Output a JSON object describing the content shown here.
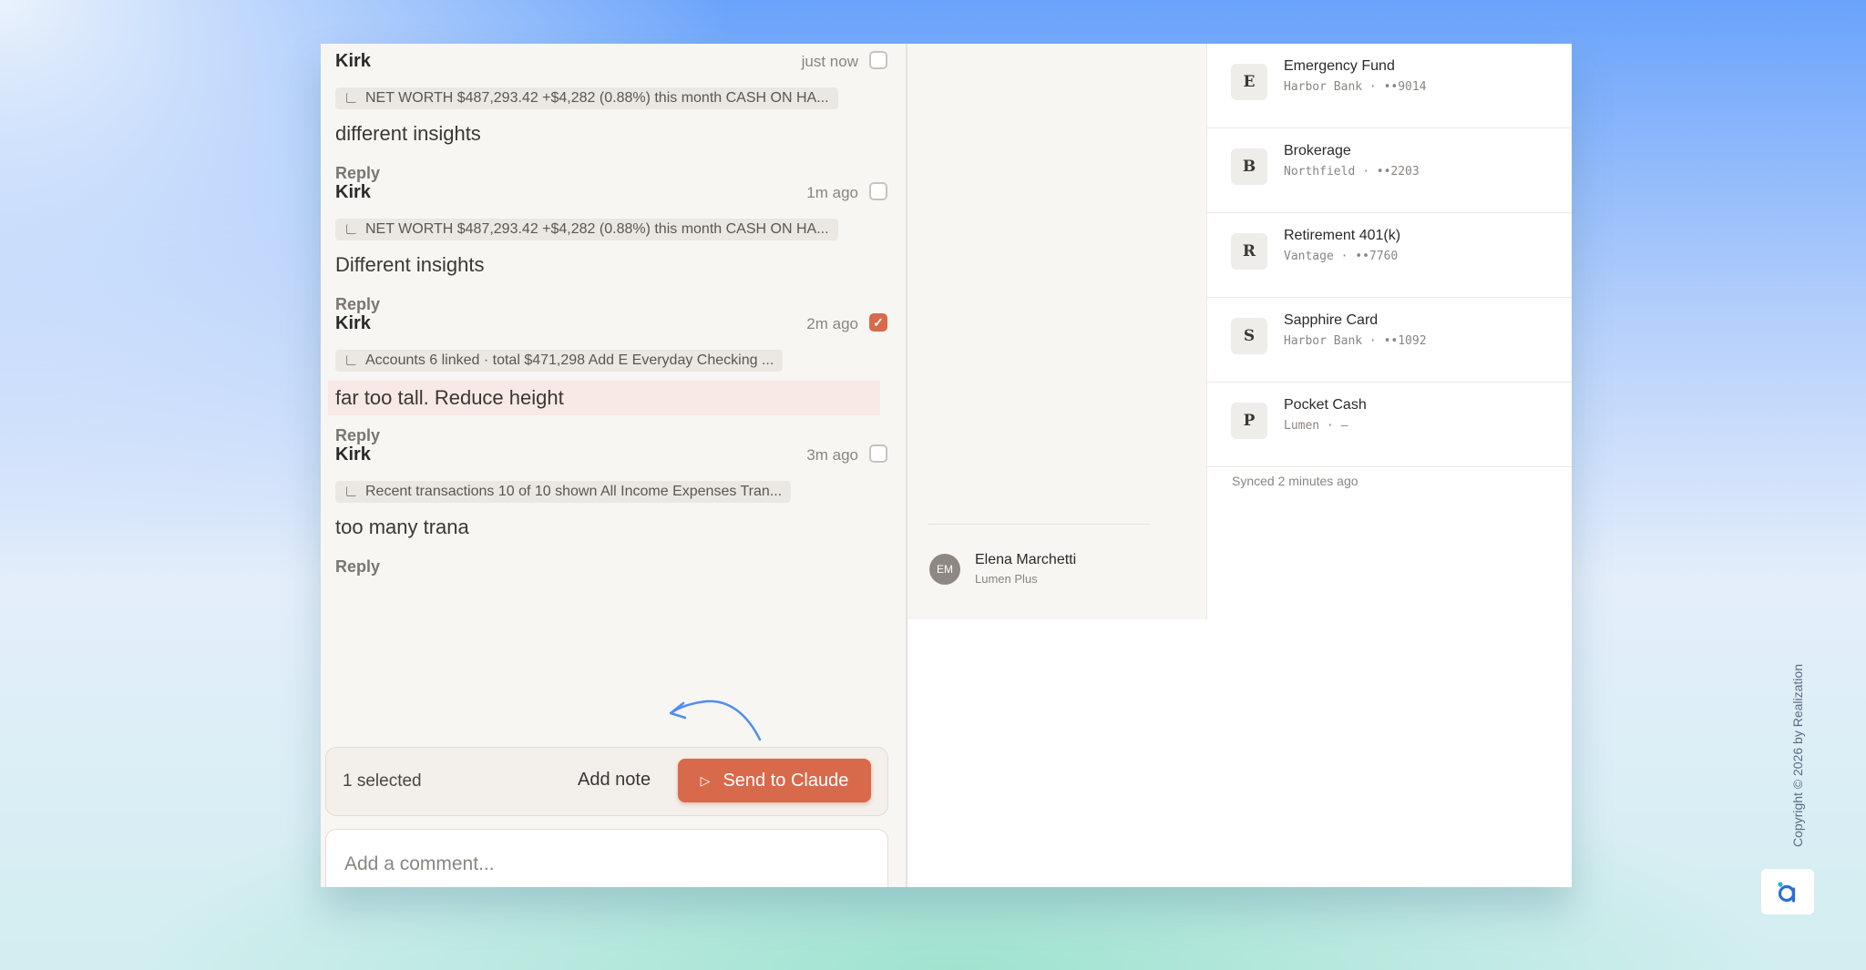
{
  "comments": [
    {
      "author": "Kirk",
      "time": "just now",
      "checked": false,
      "ref": "NET WORTH $487,293.42 +$4,282 (0.88%) this month CASH ON HA...",
      "text": "different insights",
      "reply": "Reply"
    },
    {
      "author": "Kirk",
      "time": "1m ago",
      "checked": false,
      "ref": "NET WORTH $487,293.42 +$4,282 (0.88%) this month CASH ON HA...",
      "text": "Different insights",
      "reply": "Reply"
    },
    {
      "author": "Kirk",
      "time": "2m ago",
      "checked": true,
      "ref": "Accounts 6 linked · total $471,298 Add E Everyday Checking ...",
      "text": "far too tall. Reduce height",
      "reply": "Reply"
    },
    {
      "author": "Kirk",
      "time": "3m ago",
      "checked": false,
      "ref": "Recent transactions 10 of 10 shown All Income Expenses Tran...",
      "text": "too many trana",
      "reply": "Reply"
    }
  ],
  "action_bar": {
    "selected": "1 selected",
    "add_note": "Add note",
    "send": "Send to Claude"
  },
  "comment_input": {
    "placeholder": "Add a comment..."
  },
  "user": {
    "initials": "EM",
    "name": "Elena Marchetti",
    "plan": "Lumen Plus"
  },
  "accounts": [
    {
      "badge": "E",
      "name": "Emergency Fund",
      "sub": "Harbor Bank · ••9014"
    },
    {
      "badge": "B",
      "name": "Brokerage",
      "sub": "Northfield · ••2203"
    },
    {
      "badge": "R",
      "name": "Retirement 401(k)",
      "sub": "Vantage · ••7760"
    },
    {
      "badge": "S",
      "name": "Sapphire Card",
      "sub": "Harbor Bank · ••1092"
    },
    {
      "badge": "P",
      "name": "Pocket Cash",
      "sub": "Lumen · —"
    }
  ],
  "synced": "Synced 2 minutes ago",
  "copyright": "Copyright © 2026 by Realization",
  "colors": {
    "accent": "#d9694b",
    "highlight": "#f9e9e6",
    "arrow": "#4f8ef0"
  }
}
